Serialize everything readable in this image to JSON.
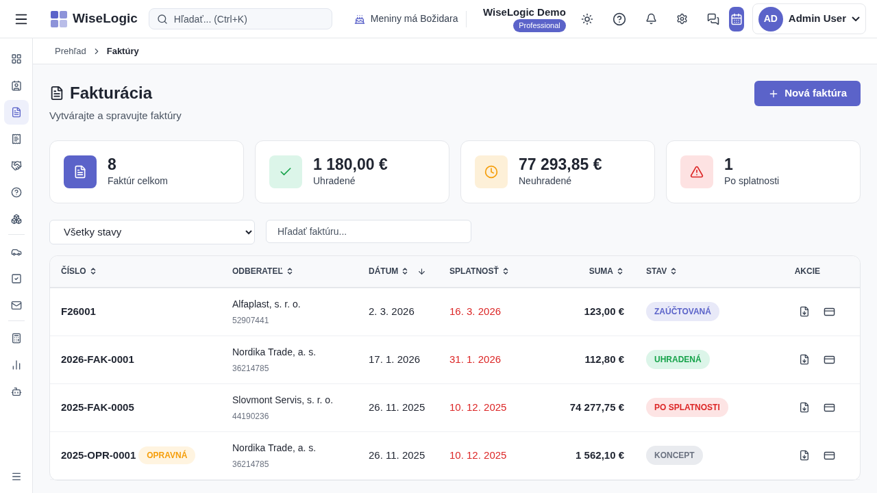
{
  "app": {
    "name": "WiseLogic"
  },
  "search": {
    "placeholder": "Hľadať... (Ctrl+K)"
  },
  "nameday": "Meniny má Božidara",
  "company": {
    "name": "WiseLogic Demo",
    "plan": "Professional"
  },
  "user": {
    "initials": "AD",
    "name": "Admin User"
  },
  "sidebar": {
    "groups": [
      [
        {
          "selected": false
        },
        {
          "selected": false
        },
        {
          "selected": true
        },
        {
          "selected": false
        },
        {
          "selected": false
        },
        {
          "selected": false
        },
        {
          "selected": false
        }
      ],
      [
        {
          "selected": false
        },
        {
          "selected": false
        },
        {
          "selected": false
        }
      ],
      [
        {
          "selected": false
        },
        {
          "selected": false
        },
        {
          "selected": false
        }
      ]
    ]
  },
  "breadcrumb": [
    "Prehľad",
    "Faktúry"
  ],
  "page": {
    "title": "Fakturácia",
    "subtitle": "Vytvárajte a spravujte faktúry",
    "new_button": "Nová faktúra"
  },
  "stats": [
    {
      "kind": "total",
      "value": "8",
      "label": "Faktúr celkom"
    },
    {
      "kind": "paid",
      "value": "1 180,00 €",
      "label": "Uhradené"
    },
    {
      "kind": "unpaid",
      "value": "77 293,85 €",
      "label": "Neuhradené"
    },
    {
      "kind": "overdue",
      "value": "1",
      "label": "Po splatnosti"
    }
  ],
  "filters": {
    "status": "Všetky stavy",
    "search_placeholder": "Hľadať faktúru..."
  },
  "table": {
    "columns": [
      {
        "label": "ČÍSLO",
        "sortable": true,
        "sorted": false
      },
      {
        "label": "ODBERATEĽ",
        "sortable": true,
        "sorted": false
      },
      {
        "label": "DÁTUM",
        "sortable": true,
        "sorted": true
      },
      {
        "label": "SPLATNOSŤ",
        "sortable": true,
        "sorted": false
      },
      {
        "label": "SUMA",
        "sortable": true,
        "sorted": false
      },
      {
        "label": "STAV",
        "sortable": true,
        "sorted": false
      },
      {
        "label": "AKCIE",
        "sortable": false,
        "sorted": false
      }
    ],
    "rows": [
      {
        "number": "F26001",
        "tag": null,
        "customer": "Alfaplast, s. r. o.",
        "customer_id": "52907441",
        "date": "2. 3. 2026",
        "due": "16. 3. 2026",
        "overdue": true,
        "amount": "123,00 €",
        "status": {
          "kind": "posted",
          "label": "ZAÚČTOVANÁ"
        }
      },
      {
        "number": "2026-FAK-0001",
        "tag": null,
        "customer": "Nordika Trade, a. s.",
        "customer_id": "36214785",
        "date": "17. 1. 2026",
        "due": "31. 1. 2026",
        "overdue": true,
        "amount": "112,80 €",
        "status": {
          "kind": "paid",
          "label": "UHRADENÁ"
        }
      },
      {
        "number": "2025-FAK-0005",
        "tag": null,
        "customer": "Slovmont Servis, s. r. o.",
        "customer_id": "44190236",
        "date": "26. 11. 2025",
        "due": "10. 12. 2025",
        "overdue": true,
        "amount": "74 277,75 €",
        "status": {
          "kind": "overdue",
          "label": "PO SPLATNOSTI"
        }
      },
      {
        "number": "2025-OPR-0001",
        "tag": "OPRAVNÁ",
        "customer": "Nordika Trade, a. s.",
        "customer_id": "36214785",
        "date": "26. 11. 2025",
        "due": "10. 12. 2025",
        "overdue": true,
        "amount": "1 562,10 €",
        "status": {
          "kind": "draft",
          "label": "KONCEPT"
        }
      }
    ]
  }
}
